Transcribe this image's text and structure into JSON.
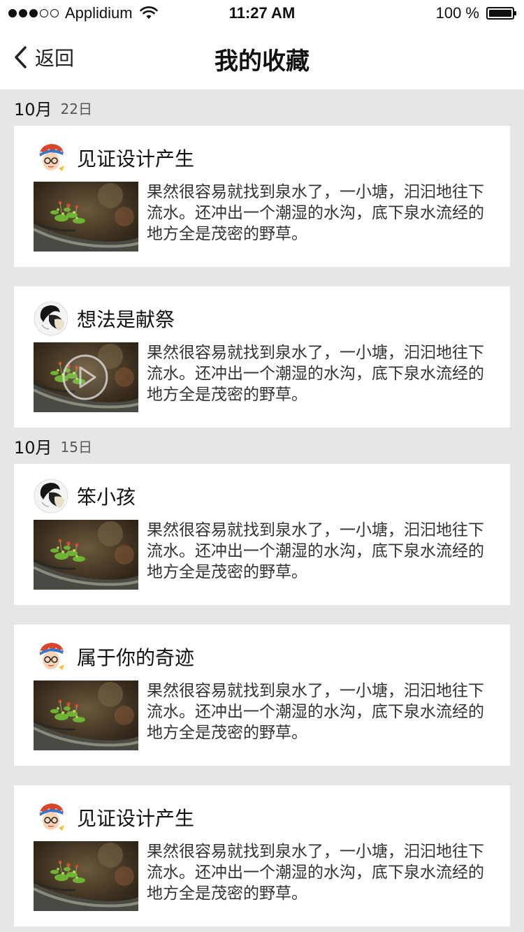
{
  "status_bar": {
    "carrier": "Applidium",
    "time": "11:27 AM",
    "battery": "100 %",
    "signal_strength": 3,
    "signal_total": 5
  },
  "nav": {
    "back_label": "返回",
    "title": "我的收藏"
  },
  "groups": [
    {
      "month": "10月",
      "day": "22日",
      "items": [
        {
          "name": "见证设计产生",
          "avatar": "red-hair-boy-avatar",
          "text": "果然很容易就找到泉水了，一小塘，汩汩地往下流水。还冲出一个潮湿的水沟，底下泉水流经的地方全是茂密的野草。",
          "video": false
        },
        {
          "name": "想法是献祭",
          "avatar": "black-hair-figure-avatar",
          "text": "果然很容易就找到泉水了，一小塘，汩汩地往下流水。还冲出一个潮湿的水沟，底下泉水流经的地方全是茂密的野草。",
          "video": true
        }
      ]
    },
    {
      "month": "10月",
      "day": "15日",
      "items": [
        {
          "name": "笨小孩",
          "avatar": "black-hair-figure-avatar",
          "text": "果然很容易就找到泉水了，一小塘，汩汩地往下流水。还冲出一个潮湿的水沟，底下泉水流经的地方全是茂密的野草。",
          "video": false
        },
        {
          "name": "属于你的奇迹",
          "avatar": "red-hair-boy-avatar",
          "text": "果然很容易就找到泉水了，一小塘，汩汩地往下流水。还冲出一个潮湿的水沟，底下泉水流经的地方全是茂密的野草。",
          "video": false
        },
        {
          "name": "见证设计产生",
          "avatar": "red-hair-boy-avatar",
          "text": "果然很容易就找到泉水了，一小塘，汩汩地往下流水。还冲出一个潮湿的水沟，底下泉水流经的地方全是茂密的野草。",
          "video": false
        }
      ]
    }
  ],
  "colors": {
    "background": "#e6e6e6",
    "card": "#ffffff",
    "text": "#222222"
  },
  "icons": {
    "back": "chevron-left-icon",
    "wifi": "wifi-icon",
    "battery": "battery-icon",
    "play": "play-icon"
  }
}
